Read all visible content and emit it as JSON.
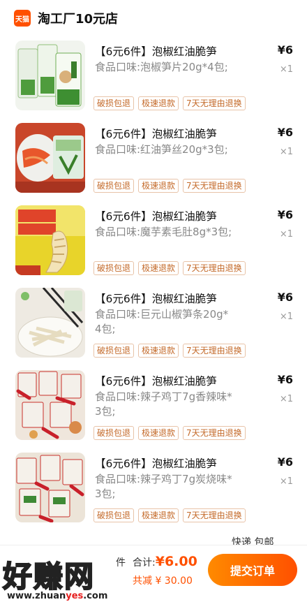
{
  "shop": {
    "logo_text": "天猫",
    "name": "淘工厂10元店"
  },
  "items": [
    {
      "title": "【6元6件】泡椒红油脆笋",
      "variant": "食品口味:泡椒笋片20g*4包;",
      "price": "¥6",
      "qty": "×1",
      "tags": [
        "破损包退",
        "极速退款",
        "7天无理由退换"
      ],
      "image": "pickled-pepper-bamboo-packs"
    },
    {
      "title": "【6元6件】泡椒红油脆笋",
      "variant": "食品口味:红油笋丝20g*3包;",
      "price": "¥6",
      "qty": "×1",
      "tags": [
        "破损包退",
        "极速退款",
        "7天无理由退换"
      ],
      "image": "red-oil-bamboo-shreds"
    },
    {
      "title": "【6元6件】泡椒红油脆笋",
      "variant": "食品口味:魔芋素毛肚8g*3包;",
      "price": "¥6",
      "qty": "×1",
      "tags": [
        "破损包退",
        "极速退款",
        "7天无理由退换"
      ],
      "image": "konjac-tripe"
    },
    {
      "title": "【6元6件】泡椒红油脆笋",
      "variant": "食品口味:巨元山椒笋条20g*4包;",
      "price": "¥6",
      "qty": "×1",
      "tags": [
        "破损包退",
        "极速退款",
        "7天无理由退换"
      ],
      "image": "pepper-bamboo-strips"
    },
    {
      "title": "【6元6件】泡椒红油脆笋",
      "variant": "食品口味:辣子鸡丁7g香辣味*3包;",
      "price": "¥6",
      "qty": "×1",
      "tags": [
        "破损包退",
        "极速退款",
        "7天无理由退换"
      ],
      "image": "spicy-chicken-cubes"
    },
    {
      "title": "【6元6件】泡椒红油脆笋",
      "variant": "食品口味:辣子鸡丁7g炭烧味*3包;",
      "price": "¥6",
      "qty": "×1",
      "tags": [
        "破损包退",
        "极速退款",
        "7天无理由退换"
      ],
      "image": "charcoal-chicken-cubes"
    }
  ],
  "delivery_label": "快递 包邮",
  "summary": {
    "count_label": "件",
    "total_label": "合计:",
    "total_amount": "¥6.00",
    "discount_label": "共减 ¥ 30.00",
    "submit_label": "提交订单"
  },
  "watermark": {
    "text": "好赚网",
    "url_prefix": "www.zhuan",
    "url_highlight": "yes",
    "url_suffix": ".com"
  },
  "colors": {
    "accent": "#ff5000",
    "tag_text": "#c46a2a",
    "tag_border": "#e8c3a8"
  }
}
